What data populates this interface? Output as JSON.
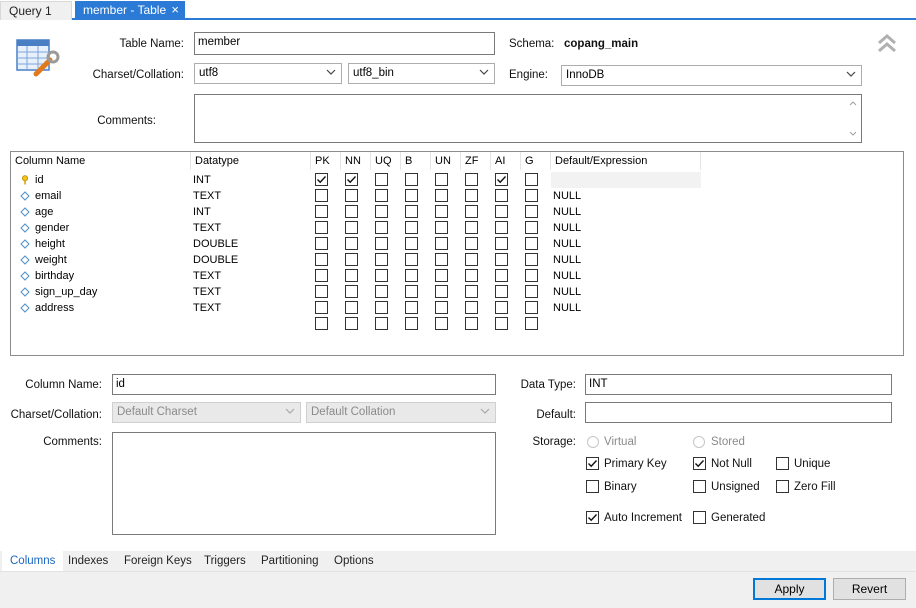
{
  "tabs": [
    {
      "label": "Query 1",
      "active": false
    },
    {
      "label": "member - Table",
      "active": true
    }
  ],
  "header": {
    "table_name_label": "Table Name:",
    "table_name_value": "member",
    "schema_label": "Schema:",
    "schema_value": "copang_main",
    "charset_label": "Charset/Collation:",
    "charset_value": "utf8",
    "collation_value": "utf8_bin",
    "engine_label": "Engine:",
    "engine_value": "InnoDB",
    "comments_label": "Comments:"
  },
  "grid": {
    "columns": [
      "Column Name",
      "Datatype",
      "PK",
      "NN",
      "UQ",
      "B",
      "UN",
      "ZF",
      "AI",
      "G",
      "Default/Expression"
    ],
    "rows": [
      {
        "name": "id",
        "type": "INT",
        "flags": [
          true,
          true,
          false,
          false,
          false,
          false,
          true,
          false
        ],
        "default": "",
        "icon": "key-icon"
      },
      {
        "name": "email",
        "type": "TEXT",
        "flags": [
          false,
          false,
          false,
          false,
          false,
          false,
          false,
          false
        ],
        "default": "NULL",
        "icon": "diamond-icon"
      },
      {
        "name": "age",
        "type": "INT",
        "flags": [
          false,
          false,
          false,
          false,
          false,
          false,
          false,
          false
        ],
        "default": "NULL",
        "icon": "diamond-icon"
      },
      {
        "name": "gender",
        "type": "TEXT",
        "flags": [
          false,
          false,
          false,
          false,
          false,
          false,
          false,
          false
        ],
        "default": "NULL",
        "icon": "diamond-icon"
      },
      {
        "name": "height",
        "type": "DOUBLE",
        "flags": [
          false,
          false,
          false,
          false,
          false,
          false,
          false,
          false
        ],
        "default": "NULL",
        "icon": "diamond-icon"
      },
      {
        "name": "weight",
        "type": "DOUBLE",
        "flags": [
          false,
          false,
          false,
          false,
          false,
          false,
          false,
          false
        ],
        "default": "NULL",
        "icon": "diamond-icon"
      },
      {
        "name": "birthday",
        "type": "TEXT",
        "flags": [
          false,
          false,
          false,
          false,
          false,
          false,
          false,
          false
        ],
        "default": "NULL",
        "icon": "diamond-icon"
      },
      {
        "name": "sign_up_day",
        "type": "TEXT",
        "flags": [
          false,
          false,
          false,
          false,
          false,
          false,
          false,
          false
        ],
        "default": "NULL",
        "icon": "diamond-icon"
      },
      {
        "name": "address",
        "type": "TEXT",
        "flags": [
          false,
          false,
          false,
          false,
          false,
          false,
          false,
          false
        ],
        "default": "NULL",
        "icon": "diamond-icon"
      },
      {
        "name": "",
        "type": "",
        "flags": [
          false,
          false,
          false,
          false,
          false,
          false,
          false,
          false
        ],
        "default": "",
        "icon": ""
      }
    ]
  },
  "detail": {
    "column_name_label": "Column Name:",
    "column_name_value": "id",
    "charset_label": "Charset/Collation:",
    "charset_value": "Default Charset",
    "collation_value": "Default Collation",
    "comments_label": "Comments:",
    "datatype_label": "Data Type:",
    "datatype_value": "INT",
    "default_label": "Default:",
    "default_value": "",
    "storage_label": "Storage:",
    "virtual_label": "Virtual",
    "stored_label": "Stored",
    "primary_key_label": "Primary Key",
    "not_null_label": "Not Null",
    "unique_label": "Unique",
    "binary_label": "Binary",
    "unsigned_label": "Unsigned",
    "zero_fill_label": "Zero Fill",
    "auto_increment_label": "Auto Increment",
    "generated_label": "Generated",
    "primary_key": true,
    "not_null": true,
    "unique": false,
    "binary": false,
    "unsigned": false,
    "zero_fill": false,
    "auto_increment": true,
    "generated": false
  },
  "bottom_tabs": [
    "Columns",
    "Indexes",
    "Foreign Keys",
    "Triggers",
    "Partitioning",
    "Options"
  ],
  "buttons": {
    "apply": "Apply",
    "revert": "Revert"
  },
  "colors": {
    "accent": "#2b7bd6",
    "active_tab_text": "#1a67c2"
  }
}
